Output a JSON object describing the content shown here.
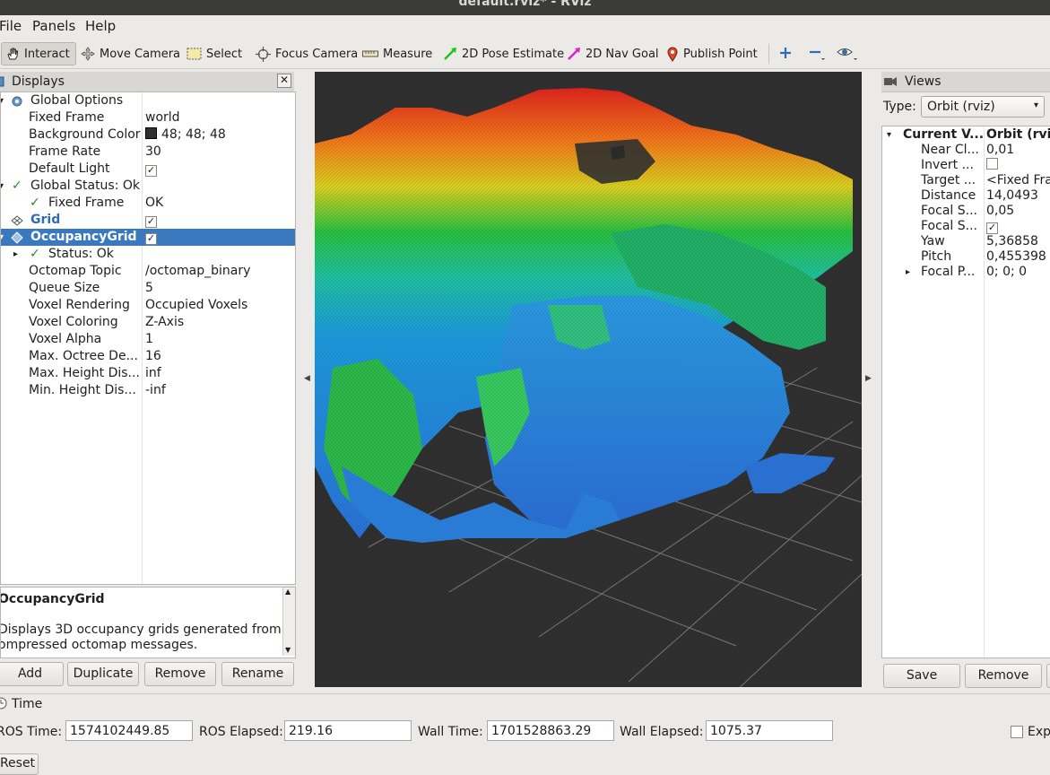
{
  "window": {
    "title": "default.rviz* - RViz"
  },
  "menu": [
    "File",
    "Panels",
    "Help"
  ],
  "toolbar": {
    "interact": "Interact",
    "move_camera": "Move Camera",
    "select": "Select",
    "focus_camera": "Focus Camera",
    "measure": "Measure",
    "pose_estimate": "2D Pose Estimate",
    "nav_goal": "2D Nav Goal",
    "publish_point": "Publish Point"
  },
  "displays": {
    "title": "Displays",
    "global_options": "Global Options",
    "fixed_frame": {
      "key": "Fixed Frame",
      "value": "world"
    },
    "background_color": {
      "key": "Background Color",
      "value": "48; 48; 48"
    },
    "frame_rate": {
      "key": "Frame Rate",
      "value": "30"
    },
    "default_light": {
      "key": "Default Light"
    },
    "global_status": "Global Status: Ok",
    "fixed_frame_status": {
      "key": "Fixed Frame",
      "value": "OK"
    },
    "grid": "Grid",
    "occupancy_grid": "OccupancyGrid",
    "status_ok": "Status: Ok",
    "octomap_topic": {
      "key": "Octomap Topic",
      "value": "/octomap_binary"
    },
    "queue_size": {
      "key": "Queue Size",
      "value": "5"
    },
    "voxel_rendering": {
      "key": "Voxel Rendering",
      "value": "Occupied Voxels"
    },
    "voxel_coloring": {
      "key": "Voxel Coloring",
      "value": "Z-Axis"
    },
    "voxel_alpha": {
      "key": "Voxel Alpha",
      "value": "1"
    },
    "max_octree_depth": {
      "key": "Max. Octree De...",
      "value": "16"
    },
    "max_height": {
      "key": "Max. Height Dis...",
      "value": "inf"
    },
    "min_height": {
      "key": "Min. Height Dis...",
      "value": "-inf"
    },
    "description_title": "OccupancyGrid",
    "description_text_1": "Displays 3D occupancy grids generated from",
    "description_text_2": "ompressed octomap messages.",
    "buttons": {
      "add": "Add",
      "duplicate": "Duplicate",
      "remove": "Remove",
      "rename": "Rename"
    }
  },
  "views": {
    "title": "Views",
    "type_label": "Type:",
    "type_value": "Orbit (rviz)",
    "current_view": {
      "key": "Current V...",
      "value": "Orbit (rviz"
    },
    "near_clip": {
      "key": "Near Cl...",
      "value": "0,01"
    },
    "invert": {
      "key": "Invert ..."
    },
    "target": {
      "key": "Target ...",
      "value": "<Fixed Fran"
    },
    "distance": {
      "key": "Distance",
      "value": "14,0493"
    },
    "focal_s1": {
      "key": "Focal S...",
      "value": "0,05"
    },
    "focal_s2": {
      "key": "Focal S..."
    },
    "yaw": {
      "key": "Yaw",
      "value": "5,36858"
    },
    "pitch": {
      "key": "Pitch",
      "value": "0,455398"
    },
    "focal_p": {
      "key": "Focal P...",
      "value": "0; 0; 0"
    },
    "buttons": {
      "save": "Save",
      "remove": "Remove"
    }
  },
  "time": {
    "title": "Time",
    "ros_time_label": "ROS Time:",
    "ros_time": "1574102449.85",
    "ros_elapsed_label": "ROS Elapsed:",
    "ros_elapsed": "219.16",
    "wall_time_label": "Wall Time:",
    "wall_time": "1701528863.29",
    "wall_elapsed_label": "Wall Elapsed:",
    "wall_elapsed": "1075.37",
    "experimental_label": "Exp",
    "reset": "Reset"
  },
  "colors": {
    "background": "#303030",
    "selection": "#3a79bd"
  }
}
